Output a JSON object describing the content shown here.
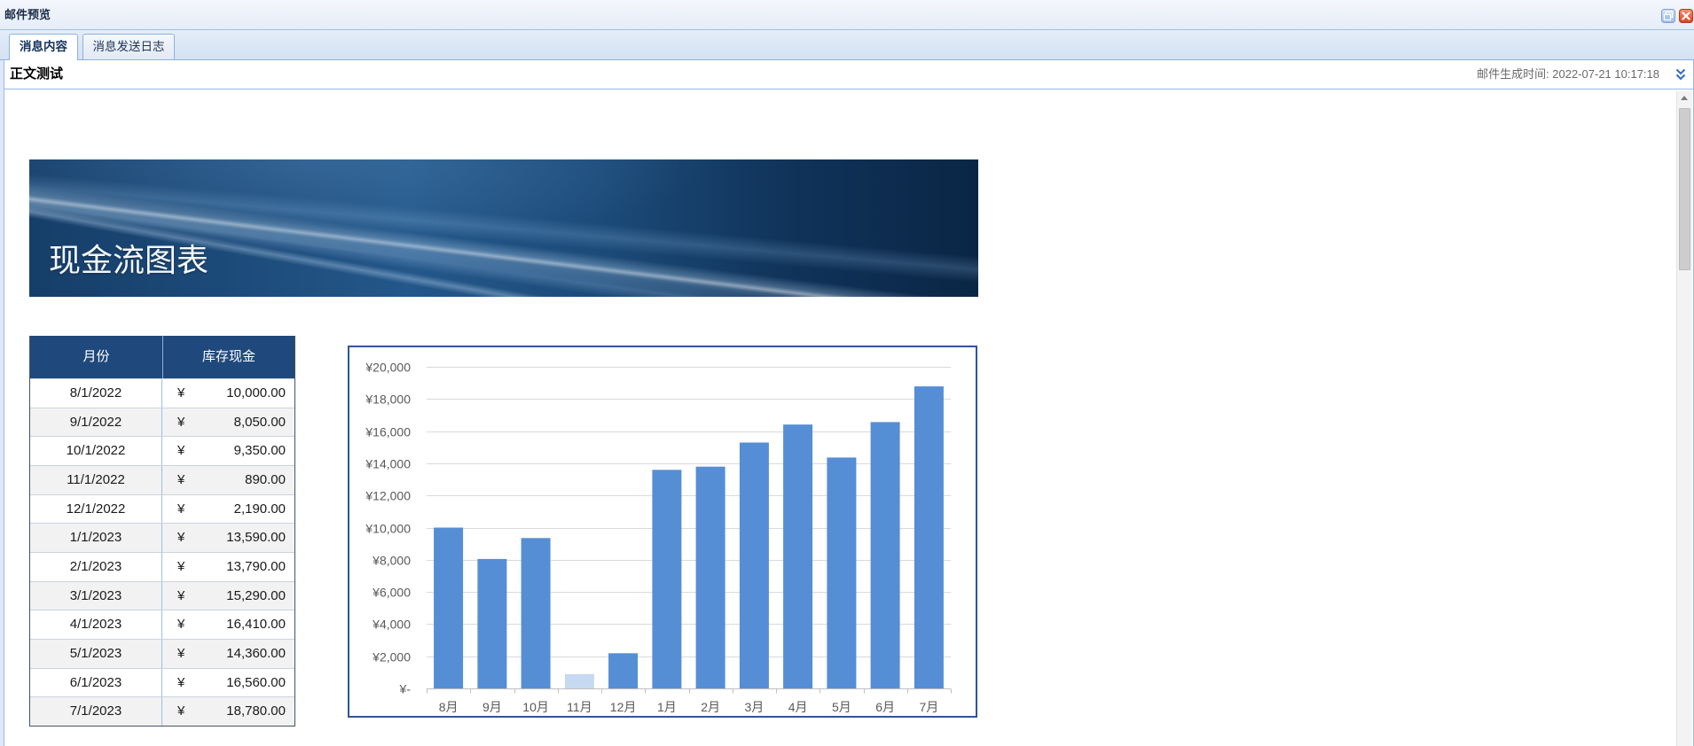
{
  "window": {
    "title": "邮件预览",
    "icons": {
      "restore": "restore-window-icon",
      "close": "close-icon"
    }
  },
  "tabs": [
    {
      "label": "消息内容",
      "active": true
    },
    {
      "label": "消息发送日志",
      "active": false
    }
  ],
  "message": {
    "subject": "正文测试",
    "generated_time": "邮件生成时间: 2022-07-21 10:17:18",
    "toggle_icon": "double-chevron-down-icon"
  },
  "banner": {
    "title": "现金流图表"
  },
  "table": {
    "headers": [
      "月份",
      "库存现金"
    ],
    "currency_symbol": "¥",
    "rows": [
      {
        "month": "8/1/2022",
        "amount": "10,000.00"
      },
      {
        "month": "9/1/2022",
        "amount": "8,050.00"
      },
      {
        "month": "10/1/2022",
        "amount": "9,350.00"
      },
      {
        "month": "11/1/2022",
        "amount": "890.00"
      },
      {
        "month": "12/1/2022",
        "amount": "2,190.00"
      },
      {
        "month": "1/1/2023",
        "amount": "13,590.00"
      },
      {
        "month": "2/1/2023",
        "amount": "13,790.00"
      },
      {
        "month": "3/1/2023",
        "amount": "15,290.00"
      },
      {
        "month": "4/1/2023",
        "amount": "16,410.00"
      },
      {
        "month": "5/1/2023",
        "amount": "14,360.00"
      },
      {
        "month": "6/1/2023",
        "amount": "16,560.00"
      },
      {
        "month": "7/1/2023",
        "amount": "18,780.00"
      }
    ]
  },
  "chart_data": {
    "type": "bar",
    "categories": [
      "8月",
      "9月",
      "10月",
      "11月",
      "12月",
      "1月",
      "2月",
      "3月",
      "4月",
      "5月",
      "6月",
      "7月"
    ],
    "values": [
      10000,
      8050,
      9350,
      890,
      2190,
      13590,
      13790,
      15290,
      16410,
      14360,
      16560,
      18780
    ],
    "ylim": [
      0,
      20000
    ],
    "yticks": [
      0,
      2000,
      4000,
      6000,
      8000,
      10000,
      12000,
      14000,
      16000,
      18000,
      20000
    ],
    "ytick_labels": [
      "¥-",
      "¥2,000",
      "¥4,000",
      "¥6,000",
      "¥8,000",
      "¥10,000",
      "¥12,000",
      "¥14,000",
      "¥16,000",
      "¥18,000",
      "¥20,000"
    ],
    "grid": true,
    "legend": "none",
    "bar_colors": [
      "#558ed5",
      "#558ed5",
      "#558ed5",
      "#c6d9f1",
      "#558ed5",
      "#558ed5",
      "#558ed5",
      "#558ed5",
      "#558ed5",
      "#558ed5",
      "#558ed5",
      "#558ed5"
    ]
  },
  "scrollbar": {
    "up_icon": "scroll-up-arrow-icon"
  },
  "colors": {
    "table_header": "#1f497d",
    "chart_border": "#2f5597",
    "gridline": "#d9d9d9",
    "axis_text": "#595959"
  }
}
